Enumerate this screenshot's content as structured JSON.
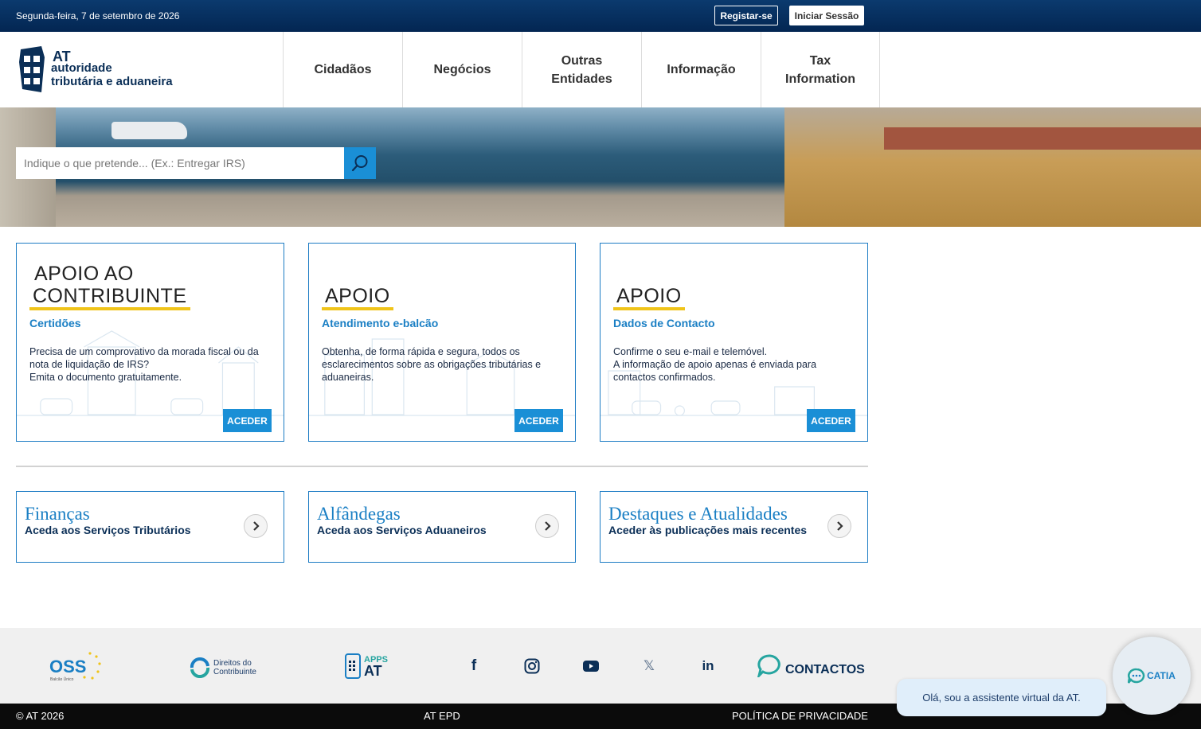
{
  "topbar": {
    "date": "Segunda-feira, 7 de setembro de 2026",
    "register_label": "Registar-se",
    "login_label": "Iniciar Sessão"
  },
  "logo": {
    "line1": "AT",
    "line2": "autoridade",
    "line3": "tributária e aduaneira"
  },
  "nav": {
    "items": [
      {
        "label": "Cidadãos"
      },
      {
        "label": "Negócios"
      },
      {
        "label": "Outras Entidades"
      },
      {
        "label": "Informação"
      },
      {
        "label": "Tax Information"
      }
    ]
  },
  "search": {
    "placeholder": "Indique o que pretende... (Ex.: Entregar IRS)"
  },
  "cards": [
    {
      "title_line1": "APOIO AO",
      "title_line2": "CONTRIBUINTE",
      "subtitle": "Certidões",
      "desc_line1": "Precisa de um comprovativo da morada fiscal ou da nota de liquidação de IRS?",
      "desc_line2": "Emita o documento gratuitamente.",
      "button": "ACEDER"
    },
    {
      "title_line1": "APOIO",
      "subtitle": "Atendimento e-balcão",
      "desc_line1": "Obtenha, de forma rápida e segura, todos os esclarecimentos sobre as obrigações tributárias e aduaneiras.",
      "button": "ACEDER"
    },
    {
      "title_line1": "APOIO",
      "subtitle": "Dados de Contacto",
      "desc_line1": "Confirme o seu e-mail e telemóvel.",
      "desc_line2": "A informação de apoio apenas é enviada para contactos confirmados.",
      "button": "ACEDER"
    }
  ],
  "links": [
    {
      "title": "Finanças",
      "subtitle": "Aceda aos Serviços Tributários"
    },
    {
      "title": "Alfândegas",
      "subtitle": "Aceda aos Serviços Aduaneiros"
    },
    {
      "title": "Destaques e Atualidades",
      "subtitle": "Aceder às publicações mais recentes"
    }
  ],
  "footer": {
    "oss": "OSS",
    "oss_sub": "Balcão Único",
    "direitos": "Direitos do Contribuinte",
    "apps_line1": "APPS",
    "apps_line2": "AT",
    "social": [
      {
        "name": "facebook-icon",
        "glyph": "f"
      },
      {
        "name": "instagram-icon"
      },
      {
        "name": "youtube-icon"
      },
      {
        "name": "x-icon",
        "glyph": "𝕏"
      },
      {
        "name": "linkedin-icon",
        "glyph": "in"
      }
    ],
    "contactos": "CONTACTOS",
    "copyright": "© AT 2026",
    "epd": "AT EPD",
    "privacy": "POLÍTICA DE PRIVACIDADE"
  },
  "chat": {
    "message": "Olá, sou a assistente virtual da AT.",
    "name": "CATIA"
  },
  "colors": {
    "brand_blue": "#1a7fc4",
    "button_blue": "#1a8fd6",
    "navy": "#0b2f57",
    "accent_yellow": "#f0c419"
  }
}
